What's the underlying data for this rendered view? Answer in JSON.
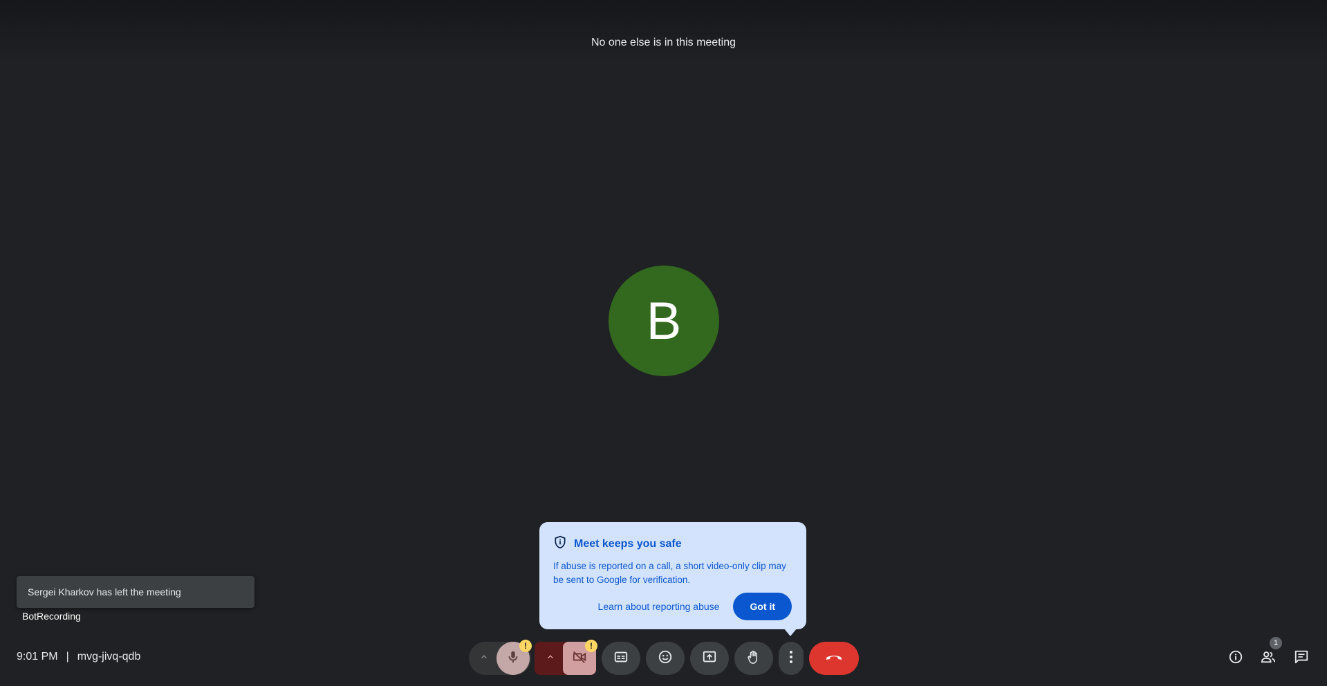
{
  "meeting": {
    "status": "No one else is in this meeting",
    "time": "9:01 PM",
    "separator": "|",
    "code": "mvg-jivq-qdb"
  },
  "participant": {
    "initial": "B",
    "name": "BotRecording",
    "avatar_color": "#33691e"
  },
  "toast": {
    "message": "Sergei Kharkov has left the meeting"
  },
  "safety_popup": {
    "title": "Meet keeps you safe",
    "body": "If abuse is reported on a call, a short video-only clip may be sent to Google for verification.",
    "link_label": "Learn about reporting abuse",
    "button_label": "Got it",
    "icon": "shield-info-icon"
  },
  "controls": {
    "mic_warning": "!",
    "cam_warning": "!",
    "buttons": [
      {
        "name": "audio-options",
        "icon": "chevron-up-icon"
      },
      {
        "name": "microphone",
        "icon": "mic-icon"
      },
      {
        "name": "video-options",
        "icon": "chevron-up-icon"
      },
      {
        "name": "camera",
        "icon": "camera-off-icon"
      },
      {
        "name": "captions",
        "icon": "captions-icon"
      },
      {
        "name": "reactions",
        "icon": "emoji-icon"
      },
      {
        "name": "present",
        "icon": "present-icon"
      },
      {
        "name": "raise-hand",
        "icon": "hand-icon"
      },
      {
        "name": "more-options",
        "icon": "more-vert-icon"
      },
      {
        "name": "leave-call",
        "icon": "hangup-icon"
      }
    ],
    "hangup_color": "#dc362e"
  },
  "side_controls": {
    "people_count": "1",
    "icons": [
      "info-icon",
      "people-icon",
      "chat-icon"
    ]
  },
  "colors": {
    "background": "#202124",
    "popup_bg": "#d3e3fd",
    "accent": "#0b57d0",
    "warning": "#fdd663"
  }
}
